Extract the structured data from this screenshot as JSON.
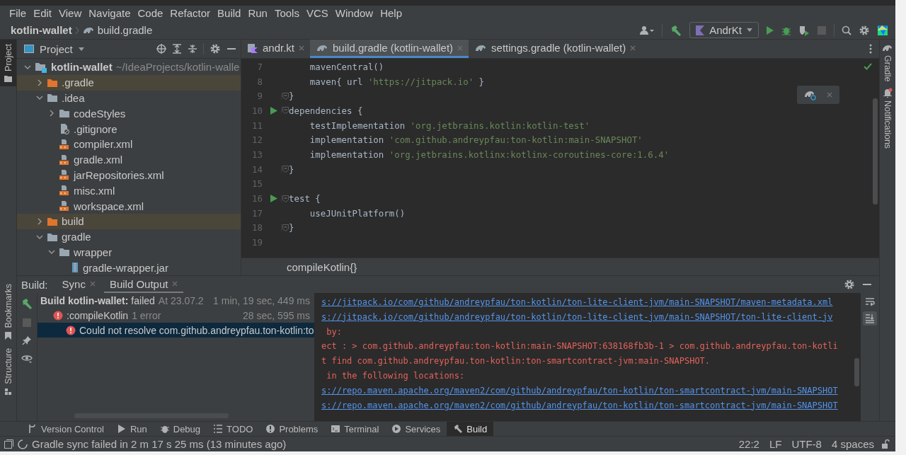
{
  "menu": {
    "items": [
      "File",
      "Edit",
      "View",
      "Navigate",
      "Code",
      "Refactor",
      "Build",
      "Run",
      "Tools",
      "VCS",
      "Window",
      "Help"
    ]
  },
  "navbar": {
    "breadcrumbs": [
      "kotlin-wallet",
      "build.gradle"
    ],
    "run_configuration": "AndrKt"
  },
  "left_stripe": {
    "top": [
      {
        "label": "Project",
        "selected": true
      }
    ],
    "bottom": [
      {
        "label": "Bookmarks",
        "selected": false
      },
      {
        "label": "Structure",
        "selected": false
      }
    ]
  },
  "right_stripe": [
    {
      "label": "Gradle",
      "kind": "gradle"
    },
    {
      "label": "Notifications",
      "kind": "notifications"
    }
  ],
  "project": {
    "title": "Project",
    "tree": [
      {
        "label": "kotlin-wallet",
        "kind": "module",
        "path": "~/IdeaProjects/kotlin-walle",
        "expanded": true,
        "excluded": false,
        "children": [
          {
            "label": ".gradle",
            "kind": "folder",
            "expanded": false,
            "excluded": true
          },
          {
            "label": ".idea",
            "kind": "folder",
            "expanded": true,
            "excluded": false,
            "children": [
              {
                "label": "codeStyles",
                "kind": "folder",
                "expanded": false,
                "excluded": false
              },
              {
                "label": ".gitignore",
                "kind": "gitignore",
                "excluded": false
              },
              {
                "label": "compiler.xml",
                "kind": "xml",
                "excluded": false
              },
              {
                "label": "gradle.xml",
                "kind": "xml",
                "excluded": false
              },
              {
                "label": "jarRepositories.xml",
                "kind": "xml",
                "excluded": false
              },
              {
                "label": "misc.xml",
                "kind": "xml",
                "excluded": false
              },
              {
                "label": "workspace.xml",
                "kind": "xml",
                "excluded": false
              }
            ]
          },
          {
            "label": "build",
            "kind": "folder",
            "expanded": false,
            "excluded": true
          },
          {
            "label": "gradle",
            "kind": "folder",
            "expanded": true,
            "excluded": false,
            "children": [
              {
                "label": "wrapper",
                "kind": "folder",
                "expanded": true,
                "excluded": false,
                "children": [
                  {
                    "label": "gradle-wrapper.jar",
                    "kind": "jar",
                    "excluded": false
                  }
                ]
              }
            ]
          }
        ]
      }
    ]
  },
  "editor": {
    "tabs": [
      {
        "label": "andr.kt",
        "kind": "kotlin",
        "selected": false
      },
      {
        "label": "build.gradle (kotlin-wallet)",
        "kind": "gradle",
        "selected": true
      },
      {
        "label": "settings.gradle (kotlin-wallet)",
        "kind": "gradle",
        "selected": false
      }
    ],
    "lines": [
      {
        "number": "7",
        "run": false,
        "fold": false,
        "segments": [
          {
            "text": "    mavenCentral()",
            "kind": "plain"
          }
        ]
      },
      {
        "number": "8",
        "run": false,
        "fold": false,
        "segments": [
          {
            "text": "    maven{ url ",
            "kind": "plain"
          },
          {
            "text": "'https://jitpack.io'",
            "kind": "string"
          },
          {
            "text": " }",
            "kind": "plain"
          }
        ]
      },
      {
        "number": "9",
        "run": false,
        "fold": true,
        "segments": [
          {
            "text": "}",
            "kind": "plain"
          }
        ]
      },
      {
        "number": "10",
        "run": true,
        "fold": true,
        "segments": [
          {
            "text": "dependencies {",
            "kind": "plain"
          }
        ]
      },
      {
        "number": "11",
        "run": false,
        "fold": false,
        "segments": [
          {
            "text": "    testImplementation ",
            "kind": "plain"
          },
          {
            "text": "'org.jetbrains.kotlin:kotlin-test'",
            "kind": "string"
          }
        ]
      },
      {
        "number": "12",
        "run": false,
        "fold": false,
        "segments": [
          {
            "text": "    implementation ",
            "kind": "plain"
          },
          {
            "text": "'com.github.andreypfau:ton-kotlin:main-SNAPSHOT'",
            "kind": "string"
          }
        ]
      },
      {
        "number": "13",
        "run": false,
        "fold": false,
        "segments": [
          {
            "text": "    implementation ",
            "kind": "plain"
          },
          {
            "text": "'org.jetbrains.kotlinx:kotlinx-coroutines-core:1.6.4'",
            "kind": "string"
          }
        ]
      },
      {
        "number": "14",
        "run": false,
        "fold": true,
        "segments": [
          {
            "text": "}",
            "kind": "plain"
          }
        ]
      },
      {
        "number": "15",
        "run": false,
        "fold": false
      },
      {
        "number": "16",
        "run": true,
        "fold": true,
        "segments": [
          {
            "text": "test {",
            "kind": "plain"
          }
        ]
      },
      {
        "number": "17",
        "run": false,
        "fold": false,
        "segments": [
          {
            "text": "    useJUnitPlatform()",
            "kind": "plain"
          }
        ]
      },
      {
        "number": "18",
        "run": false,
        "fold": true,
        "segments": [
          {
            "text": "}",
            "kind": "plain"
          }
        ]
      },
      {
        "number": "19",
        "run": false,
        "fold": false
      }
    ],
    "breadcrumb": "compileKotlin{}"
  },
  "build": {
    "label": "Build:",
    "tabs": [
      {
        "label": "Sync",
        "selected": false
      },
      {
        "label": "Build Output",
        "selected": true
      }
    ],
    "tree": [
      {
        "title": "Build kotlin-wallet:",
        "status": "failed",
        "started": "At 23.07.2",
        "duration": "1 min, 19 sec, 449 ms",
        "selected": false,
        "children": [
          {
            "title": ":compileKotlin",
            "detail": "1 error",
            "duration": "28 sec, 595 ms",
            "selected": false,
            "children": [
              {
                "title": "Could not resolve com.github.andreypfau.ton-kotlin:to",
                "selected": true
              }
            ]
          }
        ]
      }
    ],
    "console": [
      {
        "text": "s://jitpack.io/com/github/andreypfau/ton-kotlin/ton-lite-client-jvm/main-SNAPSHOT/maven-metadata.xml",
        "kind": "link"
      },
      {
        "text": "s://jitpack.io/com/github/andreypfau/ton-kotlin/ton-lite-client-jvm/main-SNAPSHOT/ton-lite-client-jv",
        "kind": "link"
      },
      {
        "text": " by:",
        "kind": "error"
      },
      {
        "text": "ect : > com.github.andreypfau:ton-kotlin:main-SNAPSHOT:638168fb3b-1 > com.github.andreypfau.ton-kotli",
        "kind": "error"
      },
      {
        "text": "t find com.github.andreypfau.ton-kotlin:ton-smartcontract-jvm:main-SNAPSHOT.",
        "kind": "error"
      },
      {
        "text": " in the following locations:",
        "kind": "error"
      },
      {
        "text": "s://repo.maven.apache.org/maven2/com/github/andreypfau/ton-kotlin/ton-smartcontract-jvm/main-SNAPSHOT",
        "kind": "link"
      },
      {
        "text": "s://repo.maven.apache.org/maven2/com/github/andreypfau/ton-kotlin/ton-smartcontract-jvm/main-SNAPSHOT",
        "kind": "link"
      }
    ]
  },
  "tool_windows": [
    {
      "label": "Version Control",
      "kind": "vcs",
      "selected": false
    },
    {
      "label": "Run",
      "kind": "run",
      "selected": false
    },
    {
      "label": "Debug",
      "kind": "debug",
      "selected": false
    },
    {
      "label": "TODO",
      "kind": "todo",
      "selected": false
    },
    {
      "label": "Problems",
      "kind": "problems",
      "selected": false
    },
    {
      "label": "Terminal",
      "kind": "terminal",
      "selected": false
    },
    {
      "label": "Services",
      "kind": "services",
      "selected": false
    },
    {
      "label": "Build",
      "kind": "build",
      "selected": true
    }
  ],
  "status_bar": {
    "message": "Gradle sync failed in 2 m 17 s 25 ms (13 minutes ago)",
    "items": [
      "22:2",
      "LF",
      "UTF-8",
      "4 spaces"
    ]
  }
}
